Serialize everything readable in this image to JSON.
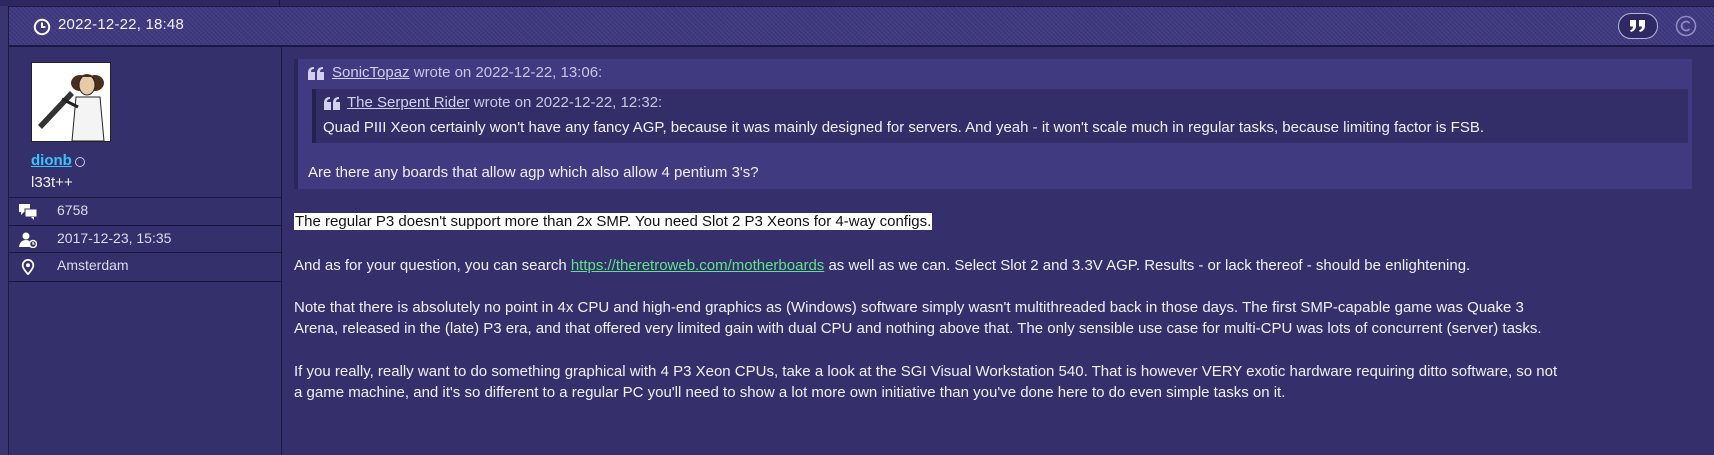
{
  "post": {
    "date": "2022-12-22, 18:48"
  },
  "author": {
    "username": "dionb",
    "title": "l33t++",
    "posts": "6758",
    "joined": "2017-12-23, 15:35",
    "location": "Amsterdam"
  },
  "quote": {
    "author": "SonicTopaz",
    "meta": "wrote on 2022-12-22, 13:06:",
    "nested": {
      "author": "The Serpent Rider",
      "meta": "wrote on 2022-12-22, 12:32:",
      "text": "Quad PIII Xeon certainly won't have any fancy AGP, because it was mainly designed for servers. And yeah - it won't scale much in regular tasks, because limiting factor is FSB."
    },
    "text": "Are there any boards that allow agp which also allow 4 pentium 3's?"
  },
  "body": {
    "p1": "The regular P3 doesn't support more than 2x SMP. You need Slot 2 P3 Xeons for 4-way configs.",
    "p2_before": "And as for your question, you can search ",
    "p2_link": "https://theretroweb.com/motherboards",
    "p2_after": " as well as we can. Select Slot 2 and 3.3V AGP. Results - or lack thereof - should be enlightening.",
    "p3": "Note that there is absolutely no point in 4x CPU and high-end graphics as (Windows) software simply wasn't multithreaded back in those days. The first SMP-capable game was Quake 3 Arena, released in the (late) P3 era, and that offered very limited gain with dual CPU and nothing above that. The only sensible use case for multi-CPU was lots of concurrent (server) tasks.",
    "p4": "If you really, really want to do something graphical with 4 P3 Xeon CPUs, take a look at the SGI Visual Workstation 540. That is however VERY exotic hardware requiring ditto software, so not a game machine, and it's so different to a regular PC you'll need to show a lot more own initiative than you've done here to do even simple tasks on it."
  },
  "colors": {
    "background": "#35306c",
    "username": "#39c3ff",
    "link": "#5fe38a"
  },
  "icons": {
    "date": "clock-icon",
    "quote_button": "quote-icon",
    "action": "copyright-icon",
    "posts": "chat-bubbles-icon",
    "joined": "user-add-icon",
    "location": "map-pin-icon",
    "quote_mark": "quote-mark-icon"
  }
}
